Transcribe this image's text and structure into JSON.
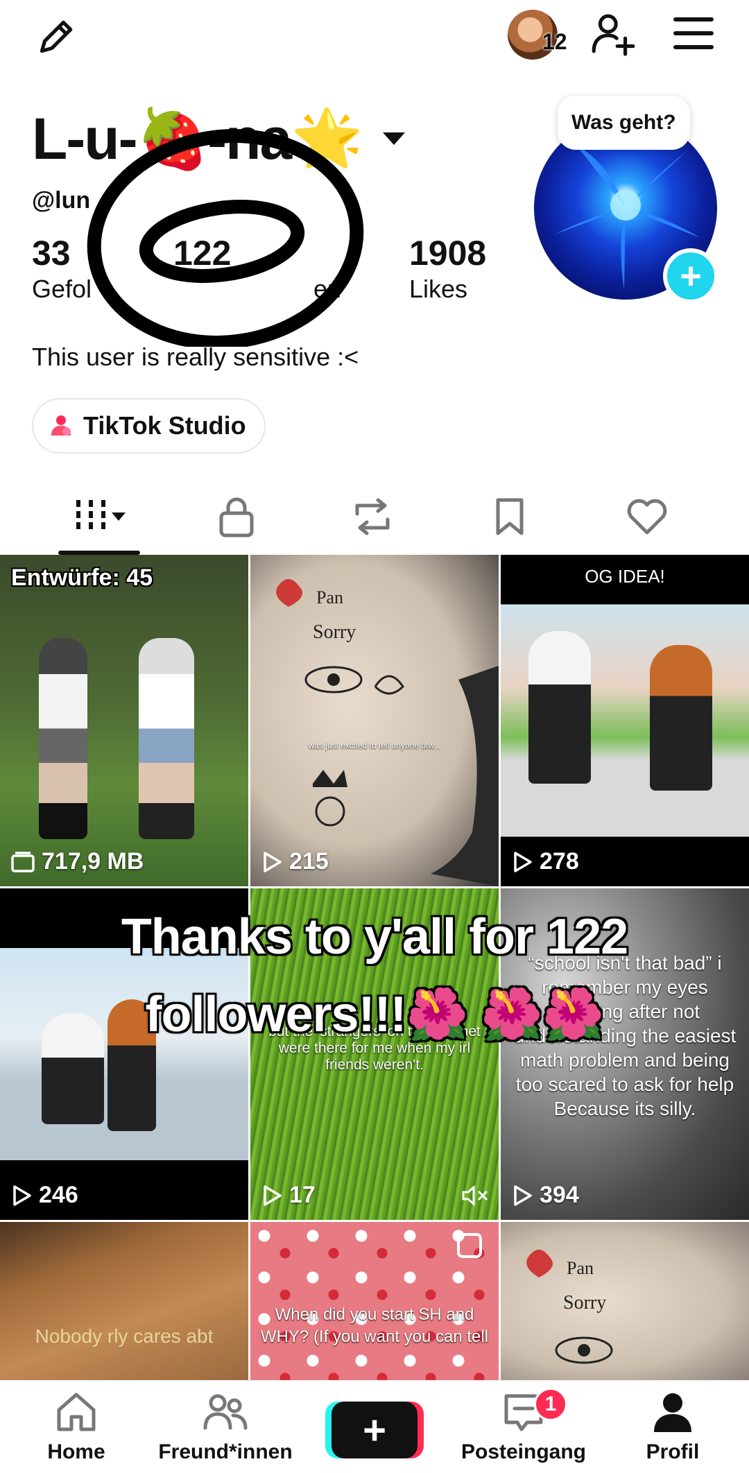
{
  "header": {
    "avatar_count": "12"
  },
  "profile": {
    "display_name": "L-u-🍓-na🌟",
    "username": "@lun",
    "stats": [
      {
        "value": "33",
        "label": "Gefol"
      },
      {
        "value": "122",
        "label": "en"
      },
      {
        "value": "1908",
        "label": "Likes"
      }
    ],
    "bio": "This user is really sensitive :<",
    "studio_button": "TikTok Studio",
    "story_bubble": "Was geht?"
  },
  "tiles": [
    {
      "caption": "Entwürfe: 45",
      "count": "717,9 MB",
      "icon": "drafts-icon"
    },
    {
      "caption": "was just excited to tell anyone btw...",
      "count": "215",
      "icon": "play-icon"
    },
    {
      "caption": "OG IDEA!",
      "count": "278",
      "icon": "play-icon"
    },
    {
      "caption": "",
      "count": "246",
      "icon": "play-icon"
    },
    {
      "caption": "but the 'strangers' on the internet were there for me when my irl friends weren't.",
      "count": "17",
      "icon": "play-icon"
    },
    {
      "caption": "“school isn't that bad” i remember my eyes watering after not understanding the easiest math problem and being too scared to ask for help Because its silly.",
      "count": "394",
      "icon": "play-icon"
    },
    {
      "caption": "Nobody rly cares abt",
      "count": "",
      "icon": ""
    },
    {
      "caption": "When did you start SH and WHY? (If you want you can tell",
      "count": "",
      "icon": ""
    },
    {
      "caption": "",
      "count": "",
      "icon": ""
    }
  ],
  "overlay": {
    "line1": "Thanks to y'all for 122",
    "line2": "followers!!!🌺 🌺🌺"
  },
  "nav": {
    "home": "Home",
    "friends": "Freund*innen",
    "create": "+",
    "inbox": "Posteingang",
    "inbox_badge": "1",
    "profile": "Profil"
  },
  "colors": {
    "accent_cyan": "#20d5ec",
    "accent_red": "#fe2c55",
    "text": "#111111"
  }
}
